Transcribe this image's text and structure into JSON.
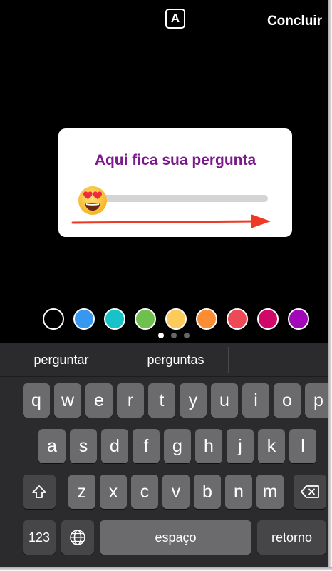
{
  "top_bar": {
    "text_style_label": "A",
    "done_label": "Concluir"
  },
  "poll_sticker": {
    "question": "Aqui fica sua pergunta",
    "emoji": "heart-eyes-emoji",
    "slider_value": 0
  },
  "palette": {
    "colors": [
      "#000000",
      "#3897f0",
      "#17c2c9",
      "#70c050",
      "#fdcb5c",
      "#fd8d32",
      "#ed4956",
      "#d10869",
      "#a307ba"
    ],
    "selected_index": 0
  },
  "page_indicator": {
    "count": 3,
    "active": 0
  },
  "keyboard": {
    "suggestions": [
      "perguntar",
      "perguntas",
      ""
    ],
    "row1": [
      "q",
      "w",
      "e",
      "r",
      "t",
      "y",
      "u",
      "i",
      "o",
      "p"
    ],
    "row2": [
      "a",
      "s",
      "d",
      "f",
      "g",
      "h",
      "j",
      "k",
      "l"
    ],
    "row3": [
      "z",
      "x",
      "c",
      "v",
      "b",
      "n",
      "m"
    ],
    "numbers_label": "123",
    "space_label": "espaço",
    "return_label": "retorno",
    "shift_icon": "shift-icon",
    "backspace_icon": "backspace-icon",
    "globe_icon": "globe-icon"
  }
}
